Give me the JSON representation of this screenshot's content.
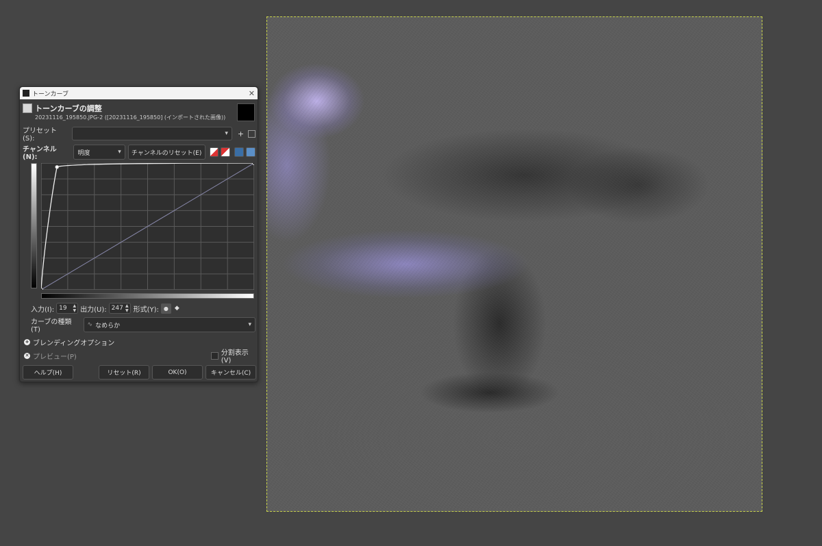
{
  "dialog": {
    "window_title": "トーンカーブ",
    "title": "トーンカーブの調整",
    "subtitle": "20231116_195850.JPG-2 ([20231116_195850] (インポートされた画像))",
    "preset_label": "プリセット(S):",
    "preset_value": "",
    "channel_label": "チャンネル(N):",
    "channel_value": "明度",
    "reset_channel_label": "チャンネルのリセット(E)",
    "input_label": "入力(I):",
    "input_value": "19",
    "output_label": "出力(U):",
    "output_value": "247",
    "type_label": "形式(Y):",
    "curve_type_label": "カーブの種類(T)",
    "curve_type_value": "なめらか",
    "blending_label": "ブレンディングオプション",
    "preview_label": "プレビュー(P)",
    "split_label": "分割表示(V)",
    "help_label": "ヘルプ(H)",
    "reset_label": "リセット(R)",
    "ok_label": "OK(O)",
    "cancel_label": "キャンセル(C)"
  },
  "curve": {
    "points": [
      [
        0,
        0
      ],
      [
        19,
        247
      ],
      [
        255,
        255
      ]
    ],
    "axis_range": [
      0,
      255
    ],
    "grid_divisions": 8
  },
  "icons": {
    "close": "close-icon",
    "add_preset": "plus-icon",
    "manage_presets": "menu-icon",
    "linear_histogram": "linear-histogram-icon",
    "log_histogram": "log-histogram-icon",
    "curve_mode": "smooth-curve-icon",
    "corner_mode": "corner-point-icon"
  }
}
